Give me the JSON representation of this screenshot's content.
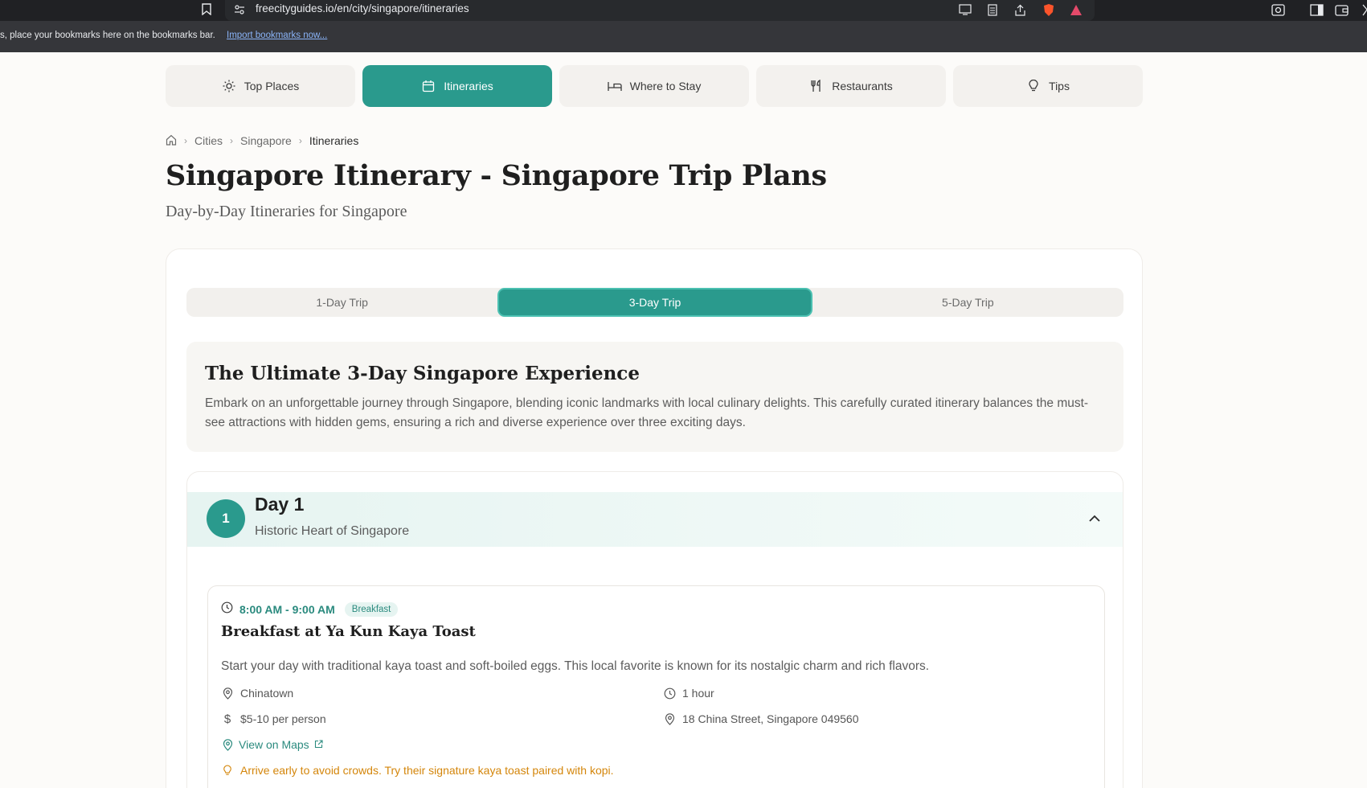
{
  "browser": {
    "url": "freecityguides.io/en/city/singapore/itineraries",
    "bookmarks_bar_text": "s, place your bookmarks here on the bookmarks bar.",
    "bookmarks_bar_link": "Import bookmarks now..."
  },
  "nav": {
    "tabs": [
      {
        "label": "Top Places",
        "icon": "sun-icon",
        "active": false
      },
      {
        "label": "Itineraries",
        "icon": "calendar-icon",
        "active": true
      },
      {
        "label": "Where to Stay",
        "icon": "bed-icon",
        "active": false
      },
      {
        "label": "Restaurants",
        "icon": "utensils-icon",
        "active": false
      },
      {
        "label": "Tips",
        "icon": "lightbulb-icon",
        "active": false
      }
    ]
  },
  "breadcrumb": {
    "items": [
      "Cities",
      "Singapore",
      "Itineraries"
    ]
  },
  "page": {
    "title": "Singapore Itinerary - Singapore Trip Plans",
    "subtitle": "Day-by-Day Itineraries for Singapore"
  },
  "trip_tabs": [
    {
      "label": "1-Day Trip",
      "active": false
    },
    {
      "label": "3-Day Trip",
      "active": true
    },
    {
      "label": "5-Day Trip",
      "active": false
    }
  ],
  "intro": {
    "title": "The Ultimate 3-Day Singapore Experience",
    "text": "Embark on an unforgettable journey through Singapore, blending iconic landmarks with local culinary delights. This carefully curated itinerary balances the must-see attractions with hidden gems, ensuring a rich and diverse experience over three exciting days."
  },
  "day": {
    "number": "1",
    "title": "Day 1",
    "subtitle": "Historic Heart of Singapore",
    "activity": {
      "time": "8:00 AM - 9:00 AM",
      "tag": "Breakfast",
      "title": "Breakfast at Ya Kun Kaya Toast",
      "description": "Start your day with traditional kaya toast and soft-boiled eggs. This local favorite is known for its nostalgic charm and rich flavors.",
      "location": "Chinatown",
      "duration": "1 hour",
      "price": "$5-10 per person",
      "address": "18 China Street, Singapore 049560",
      "maps_link": "View on Maps",
      "tip": "Arrive early to avoid crowds. Try their signature kaya toast paired with kopi."
    }
  },
  "colors": {
    "accent": "#2a9a8d",
    "tip": "#d4860b",
    "background": "#fcfbf9"
  }
}
